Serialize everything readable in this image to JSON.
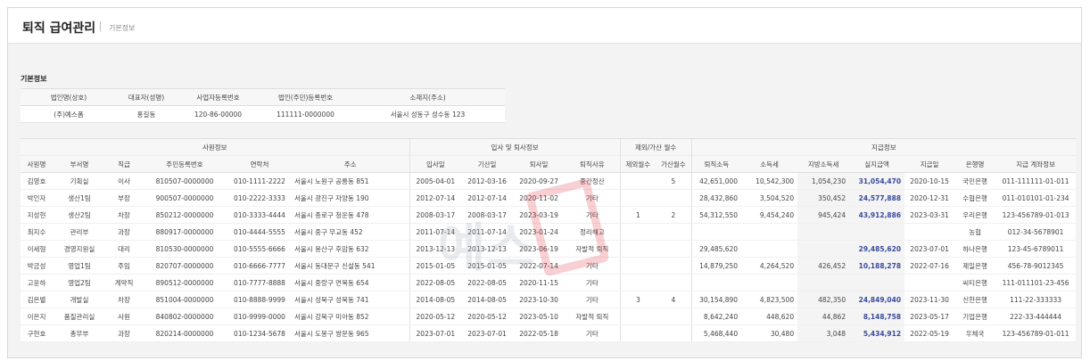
{
  "header": {
    "title": "퇴직 급여관리",
    "breadcrumb": "기본정보"
  },
  "basic": {
    "section_label": "기본정보",
    "columns": [
      "법인명(상호)",
      "대표자(성명)",
      "사업자등록번호",
      "법인(주민)등록번호",
      "소재지(주소)"
    ],
    "row": [
      "(주)예스폼",
      "홍길동",
      "120-86-00000",
      "111111-0000000",
      "서울시 성동구 성수동 123"
    ]
  },
  "employees": {
    "groups": {
      "employee_info": "사원정보",
      "join_leave": "입사 및 퇴사정보",
      "excl_add_months": "제외/가산 월수",
      "payment_info": "지급정보"
    },
    "columns": [
      "사원명",
      "부서명",
      "직급",
      "주민등록번호",
      "연락처",
      "주소",
      "입사일",
      "기산일",
      "퇴사일",
      "퇴직사유",
      "제외월수",
      "가산월수",
      "퇴직소득",
      "소득세",
      "지방소득세",
      "실지급액",
      "지급일",
      "은행명",
      "지급 계좌정보"
    ],
    "rows": [
      [
        "김영호",
        "기획실",
        "이사",
        "810507-0000000",
        "010-1111-2222",
        "서울시 노원구 공릉동 851",
        "2005-04-01",
        "2012-03-16",
        "2020-09-27",
        "중간정산",
        "",
        "5",
        "42,651,000",
        "10,542,300",
        "1,054,230",
        "31,054,470",
        "2020-10-15",
        "국민은행",
        "011-111111-01-011"
      ],
      [
        "박인자",
        "생산1팀",
        "부장",
        "900507-0000000",
        "010-2222-3333",
        "서울시 광진구 자양동 190",
        "2012-07-14",
        "2012-07-14",
        "2020-11-02",
        "기타",
        "",
        "",
        "28,432,860",
        "3,504,520",
        "350,452",
        "24,577,888",
        "2020-12-31",
        "수협은행",
        "011-010101-01-234"
      ],
      [
        "지성현",
        "생산2팀",
        "차장",
        "850212-0000000",
        "010-3333-4444",
        "서울시 종로구 청운동 478",
        "2008-03-17",
        "2008-03-17",
        "2023-03-19",
        "기타",
        "1",
        "2",
        "54,312,550",
        "9,454,240",
        "945,424",
        "43,912,886",
        "2023-03-31",
        "우리은행",
        "123-456789-01-013"
      ],
      [
        "최지수",
        "관리부",
        "과장",
        "880917-0000000",
        "010-4444-5555",
        "서울시 중구 무교동 452",
        "2011-07-14",
        "2011-07-14",
        "2023-01-24",
        "정리해고",
        "",
        "",
        "",
        "",
        "",
        "",
        "",
        "농협",
        "012-34-5678901"
      ],
      [
        "이세형",
        "경영지원실",
        "대리",
        "810530-0000000",
        "010-5555-6666",
        "서울시 용산구 후암동 632",
        "2013-12-13",
        "2013-12-13",
        "2023-06-19",
        "자발적 퇴직",
        "",
        "",
        "29,485,620",
        "",
        "",
        "29,485,620",
        "2023-07-01",
        "하나은행",
        "123-45-6789011"
      ],
      [
        "박금성",
        "영업1팀",
        "주임",
        "820707-0000000",
        "010-6666-7777",
        "서울시 동대문구 신설동 541",
        "2015-01-05",
        "2015-01-05",
        "2022-07-14",
        "기타",
        "",
        "",
        "14,879,250",
        "4,264,520",
        "426,452",
        "10,188,278",
        "2022-07-16",
        "제일은행",
        "456-78-9012345"
      ],
      [
        "고윤하",
        "영업2팀",
        "계약직",
        "890512-0000000",
        "010-7777-8888",
        "서울시 중랑구 면목동 654",
        "2022-08-05",
        "2022-08-05",
        "2020-11-15",
        "기타",
        "",
        "",
        "",
        "",
        "",
        "",
        "",
        "씨티은행",
        "111-011101-23-456"
      ],
      [
        "김은별",
        "개발실",
        "차장",
        "851004-0000000",
        "010-8888-9999",
        "서울시 성북구 성북동 741",
        "2014-08-05",
        "2014-08-05",
        "2023-10-30",
        "기타",
        "3",
        "4",
        "30,154,890",
        "4,823,500",
        "482,350",
        "24,849,040",
        "2023-11-30",
        "신한은행",
        "111-22-333333"
      ],
      [
        "이은지",
        "품질관리실",
        "사원",
        "840802-0000000",
        "010-9999-0000",
        "서울시 강북구 미아동 852",
        "2020-05-12",
        "2020-05-12",
        "2023-05-10",
        "자발적 퇴직",
        "",
        "",
        "8,642,240",
        "448,620",
        "44,862",
        "8,148,758",
        "2023-05-17",
        "기업은행",
        "222-33-444444"
      ],
      [
        "구현호",
        "총무부",
        "과장",
        "820214-0000000",
        "010-1234-5678",
        "서울시 도봉구 쌍문동 965",
        "2023-07-01",
        "2023-07-01",
        "2022-05-18",
        "기타",
        "",
        "",
        "5,468,440",
        "30,480",
        "3,048",
        "5,434,912",
        "2022-05-19",
        "우체국",
        "123-456789-01-011"
      ]
    ]
  },
  "watermark": {
    "text": "예스"
  },
  "colors": {
    "pay_amount": "#3a4a9c",
    "watermark_red": "#e0303a"
  }
}
